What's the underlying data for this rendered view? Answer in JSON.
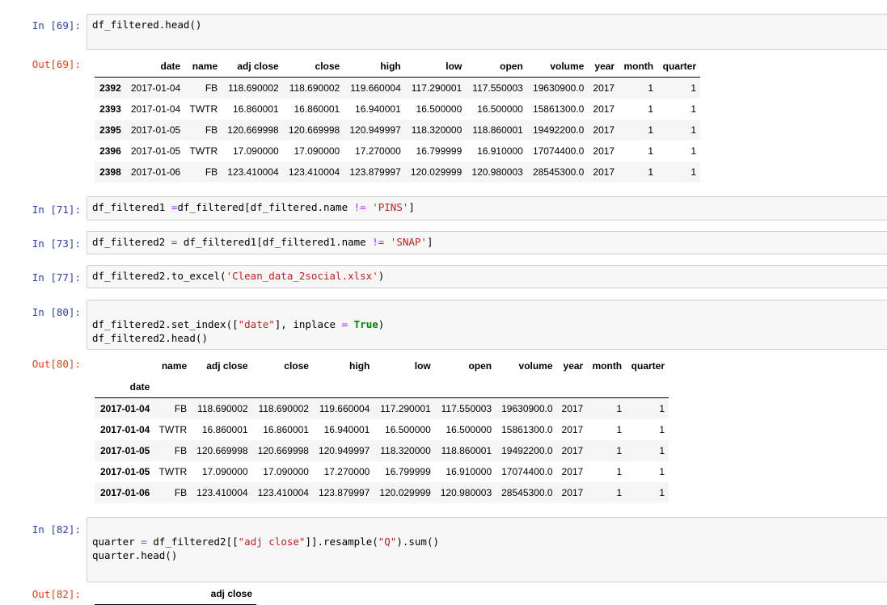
{
  "cells": [
    {
      "prompt": "In [69]:",
      "lines": [
        [
          [
            "df_filtered.head()",
            ""
          ]
        ]
      ]
    },
    {
      "prompt": "Out[69]:",
      "table": {
        "headers": [
          [
            "",
            "date",
            "name",
            "adj close",
            "close",
            "high",
            "low",
            "open",
            "volume",
            "year",
            "month",
            "quarter"
          ]
        ],
        "rows": [
          [
            "2392",
            "2017-01-04",
            "FB",
            "118.690002",
            "118.690002",
            "119.660004",
            "117.290001",
            "117.550003",
            "19630900.0",
            "2017",
            "1",
            "1"
          ],
          [
            "2393",
            "2017-01-04",
            "TWTR",
            "16.860001",
            "16.860001",
            "16.940001",
            "16.500000",
            "16.500000",
            "15861300.0",
            "2017",
            "1",
            "1"
          ],
          [
            "2395",
            "2017-01-05",
            "FB",
            "120.669998",
            "120.669998",
            "120.949997",
            "118.320000",
            "118.860001",
            "19492200.0",
            "2017",
            "1",
            "1"
          ],
          [
            "2396",
            "2017-01-05",
            "TWTR",
            "17.090000",
            "17.090000",
            "17.270000",
            "16.799999",
            "16.910000",
            "17074400.0",
            "2017",
            "1",
            "1"
          ],
          [
            "2398",
            "2017-01-06",
            "FB",
            "123.410004",
            "123.410004",
            "123.879997",
            "120.029999",
            "120.980003",
            "28545300.0",
            "2017",
            "1",
            "1"
          ]
        ]
      }
    },
    {
      "prompt": "In [71]:",
      "lines": [
        [
          [
            "df_filtered1 ",
            ""
          ],
          [
            "=",
            "op"
          ],
          [
            "df_filtered[df_filtered.name ",
            ""
          ],
          [
            "!=",
            "op"
          ],
          [
            " ",
            ""
          ],
          [
            "'PINS'",
            "str"
          ],
          [
            "]",
            ""
          ]
        ]
      ]
    },
    {
      "prompt": "In [73]:",
      "lines": [
        [
          [
            "df_filtered2 ",
            ""
          ],
          [
            "=",
            "op"
          ],
          [
            " df_filtered1[df_filtered1.name ",
            ""
          ],
          [
            "!=",
            "op"
          ],
          [
            " ",
            ""
          ],
          [
            "'SNAP'",
            "str"
          ],
          [
            "]",
            ""
          ]
        ]
      ]
    },
    {
      "prompt": "In [77]:",
      "lines": [
        [
          [
            "df_filtered2.to_excel(",
            ""
          ],
          [
            "'Clean_data_2social.xlsx'",
            "str"
          ],
          [
            ")",
            ""
          ]
        ]
      ]
    },
    {
      "prompt": "In [80]:",
      "lines": [
        [
          [
            "",
            ""
          ]
        ],
        [
          [
            "df_filtered2.set_index([",
            ""
          ],
          [
            "\"date\"",
            "str"
          ],
          [
            "], inplace ",
            ""
          ],
          [
            "=",
            "op"
          ],
          [
            " ",
            ""
          ],
          [
            "True",
            "kw"
          ],
          [
            ")",
            ""
          ]
        ],
        [
          [
            "df_filtered2.head()",
            ""
          ]
        ]
      ]
    },
    {
      "prompt": "Out[80]:",
      "table": {
        "headers": [
          [
            "",
            "name",
            "adj close",
            "close",
            "high",
            "low",
            "open",
            "volume",
            "year",
            "month",
            "quarter"
          ],
          [
            "date",
            "",
            "",
            "",
            "",
            "",
            "",
            "",
            "",
            "",
            ""
          ]
        ],
        "rows": [
          [
            "2017-01-04",
            "FB",
            "118.690002",
            "118.690002",
            "119.660004",
            "117.290001",
            "117.550003",
            "19630900.0",
            "2017",
            "1",
            "1"
          ],
          [
            "2017-01-04",
            "TWTR",
            "16.860001",
            "16.860001",
            "16.940001",
            "16.500000",
            "16.500000",
            "15861300.0",
            "2017",
            "1",
            "1"
          ],
          [
            "2017-01-05",
            "FB",
            "120.669998",
            "120.669998",
            "120.949997",
            "118.320000",
            "118.860001",
            "19492200.0",
            "2017",
            "1",
            "1"
          ],
          [
            "2017-01-05",
            "TWTR",
            "17.090000",
            "17.090000",
            "17.270000",
            "16.799999",
            "16.910000",
            "17074400.0",
            "2017",
            "1",
            "1"
          ],
          [
            "2017-01-06",
            "FB",
            "123.410004",
            "123.410004",
            "123.879997",
            "120.029999",
            "120.980003",
            "28545300.0",
            "2017",
            "1",
            "1"
          ]
        ]
      }
    },
    {
      "prompt": "In [82]:",
      "lines": [
        [
          [
            "",
            ""
          ]
        ],
        [
          [
            "quarter ",
            ""
          ],
          [
            "=",
            "op"
          ],
          [
            " df_filtered2[[",
            ""
          ],
          [
            "\"adj close\"",
            "str"
          ],
          [
            "]].resample(",
            ""
          ],
          [
            "\"Q\"",
            "str"
          ],
          [
            ").sum()",
            ""
          ]
        ],
        [
          [
            "quarter.head()",
            ""
          ]
        ],
        [
          [
            "",
            ""
          ]
        ]
      ]
    },
    {
      "prompt": "Out[82]:",
      "table": {
        "headers": [
          [
            "",
            "adj close"
          ]
        ],
        "rows": []
      }
    }
  ]
}
